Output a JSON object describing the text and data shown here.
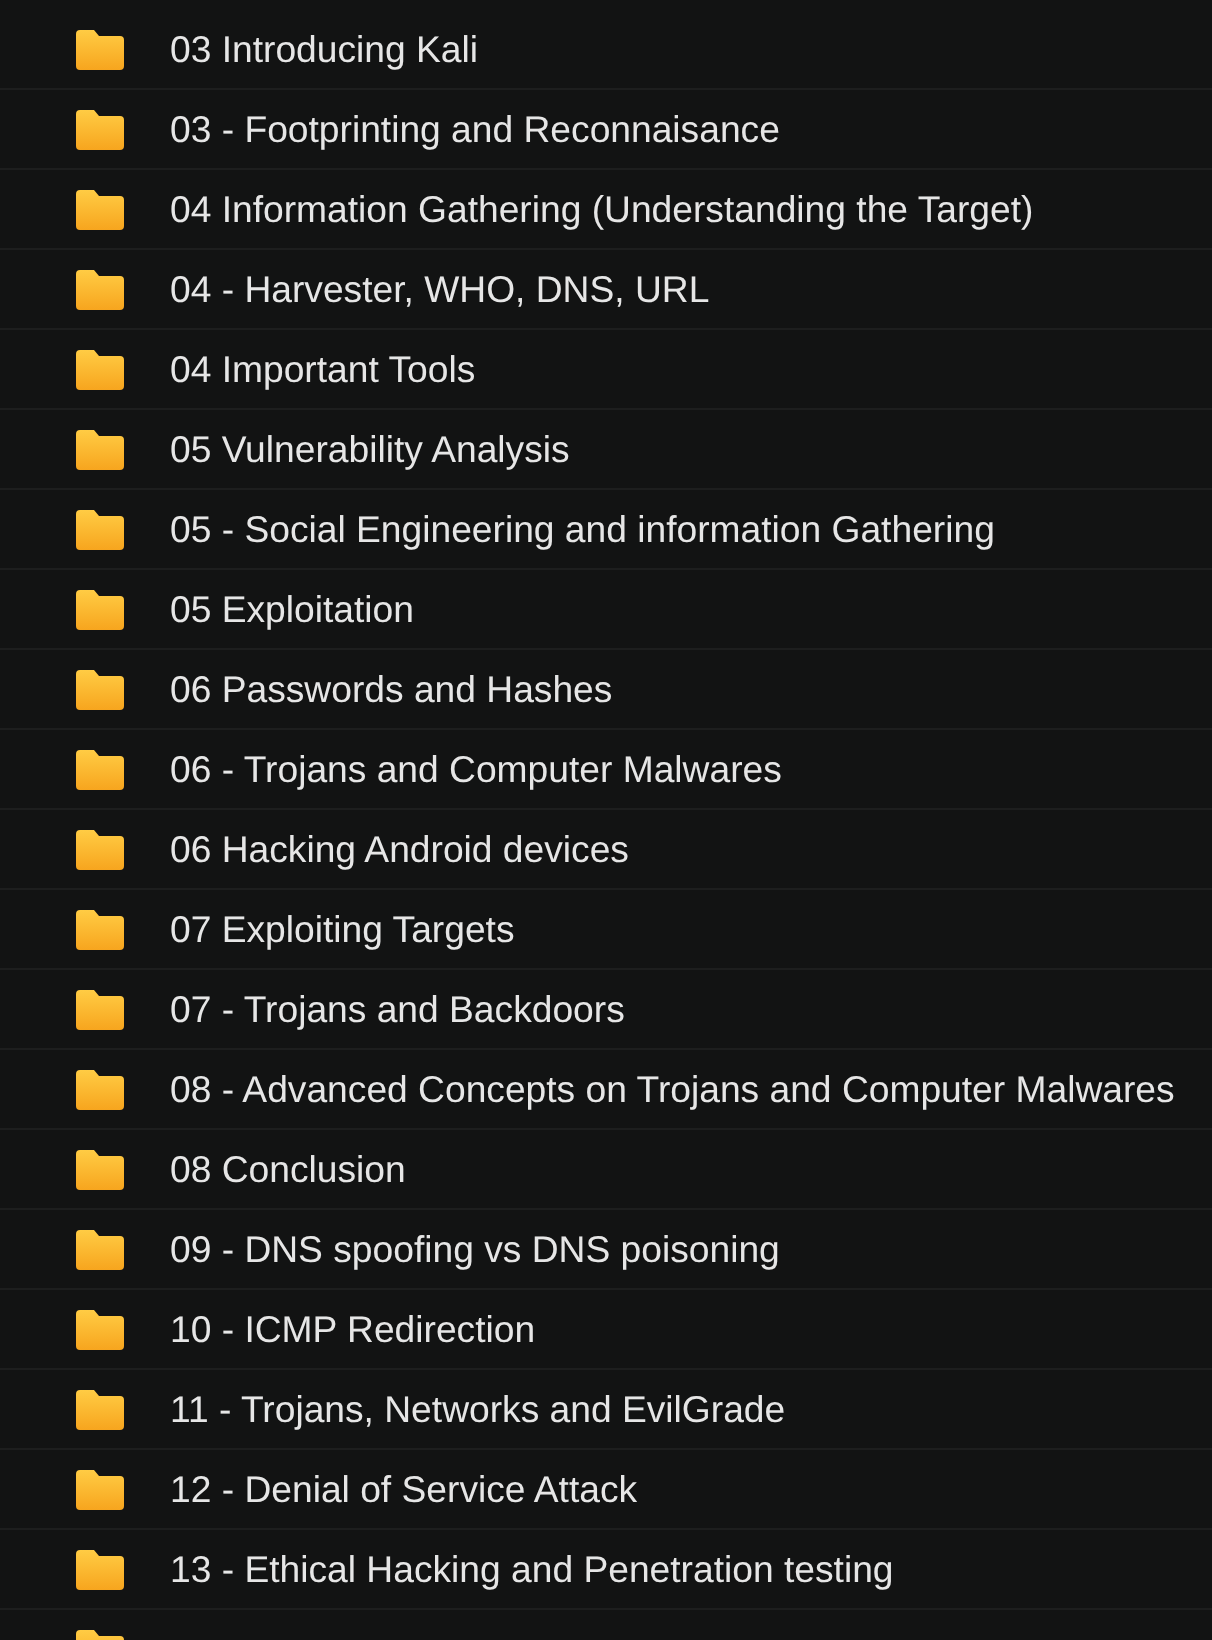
{
  "folders": [
    {
      "name": "03 Introducing Kali"
    },
    {
      "name": "03 - Footprinting and Reconnaisance"
    },
    {
      "name": "04 Information Gathering (Understanding the Target)"
    },
    {
      "name": "04 - Harvester, WHO, DNS, URL"
    },
    {
      "name": "04 Important Tools"
    },
    {
      "name": "05 Vulnerability Analysis"
    },
    {
      "name": "05 - Social Engineering and information Gathering"
    },
    {
      "name": "05 Exploitation"
    },
    {
      "name": "06 Passwords and Hashes"
    },
    {
      "name": "06 - Trojans and Computer Malwares"
    },
    {
      "name": "06 Hacking Android devices"
    },
    {
      "name": "07 Exploiting Targets"
    },
    {
      "name": "07 - Trojans and Backdoors"
    },
    {
      "name": "08 - Advanced Concepts on Trojans and Computer Malwares"
    },
    {
      "name": "08 Conclusion"
    },
    {
      "name": "09 - DNS spoofing vs DNS poisoning"
    },
    {
      "name": "10 - ICMP Redirection"
    },
    {
      "name": "11 - Trojans, Networks and EvilGrade"
    },
    {
      "name": "12 - Denial of Service Attack"
    },
    {
      "name": "13 - Ethical Hacking and Penetration testing"
    }
  ],
  "more_below": true
}
